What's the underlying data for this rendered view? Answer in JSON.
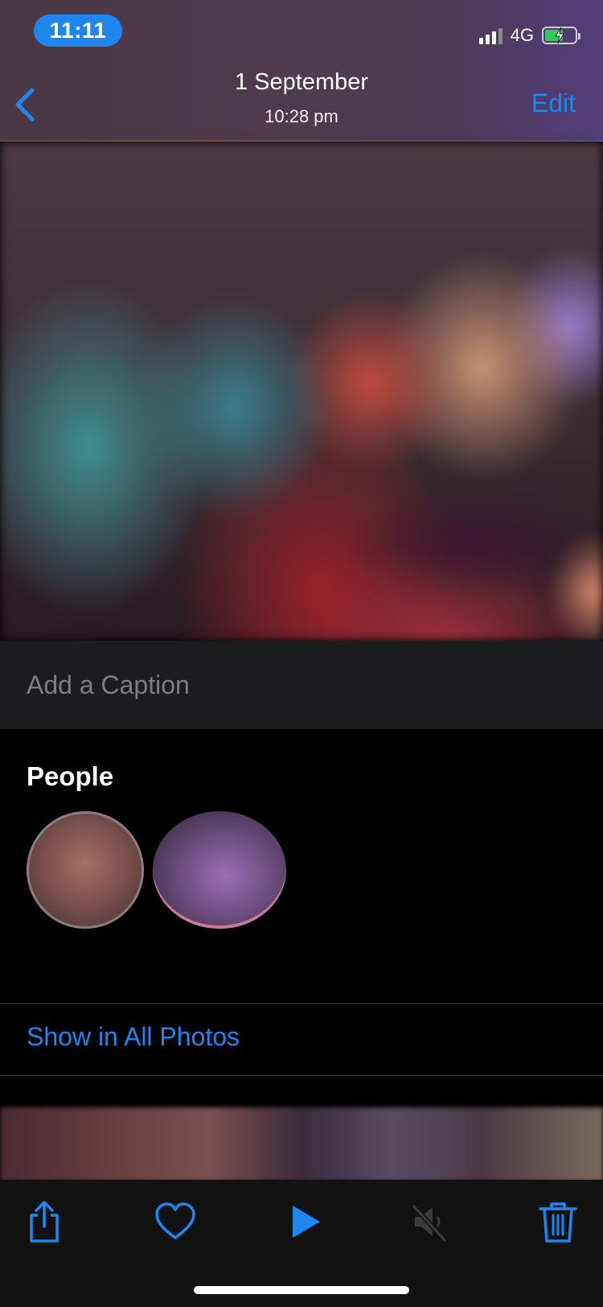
{
  "status_bar": {
    "time": "11:11",
    "network": "4G",
    "battery_charging": true
  },
  "nav": {
    "title": "1 September",
    "subtitle": "10:28 pm",
    "edit_label": "Edit",
    "back_icon": "chevron-left-icon"
  },
  "caption": {
    "placeholder": "Add a Caption"
  },
  "people": {
    "title": "People",
    "faces": [
      "person-1",
      "person-2"
    ]
  },
  "actions": {
    "show_in_all_photos": "Show in All Photos"
  },
  "toolbar": {
    "icons": [
      "share-icon",
      "heart-icon",
      "play-icon",
      "mute-icon",
      "trash-icon"
    ]
  },
  "colors": {
    "accent": "#1f86ef",
    "background": "#000000",
    "caption_bg": "#1c1c1e",
    "toolbar_bg": "#121212"
  }
}
